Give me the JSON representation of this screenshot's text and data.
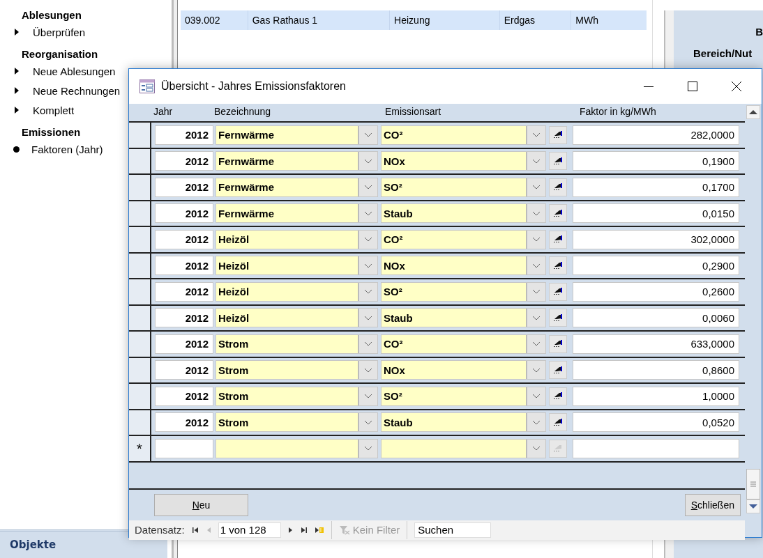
{
  "nav": {
    "sections": [
      {
        "title": "Ablesungen",
        "items": [
          {
            "label": "Überprüfen",
            "kind": "arrow"
          }
        ]
      },
      {
        "title": "Reorganisation",
        "items": [
          {
            "label": "Neue Ablesungen",
            "kind": "arrow"
          },
          {
            "label": "Neue Rechnungen",
            "kind": "arrow"
          },
          {
            "label": "Komplett",
            "kind": "arrow"
          }
        ]
      },
      {
        "title": "Emissionen",
        "items": [
          {
            "label": "Faktoren (Jahr)",
            "kind": "dot"
          }
        ]
      }
    ],
    "footer": "Objekte"
  },
  "list": {
    "rows": [
      {
        "cells": [
          "039.002",
          "Gas Rathaus 1",
          "Heizung",
          "Erdgas",
          "MWh"
        ],
        "selected": true
      }
    ]
  },
  "detail": {
    "texts": [
      "B",
      "Bereich/Nut"
    ]
  },
  "dialog": {
    "title": "Übersicht - Jahres Emissionsfaktoren",
    "columns": [
      "Jahr",
      "Bezeichnung",
      "Emissionsart",
      "Faktor in kg/MWh"
    ],
    "rows": [
      {
        "year": "2012",
        "name": "Fernwärme",
        "type": "CO²",
        "factor": "282,0000"
      },
      {
        "year": "2012",
        "name": "Fernwärme",
        "type": "NOx",
        "factor": "0,1900"
      },
      {
        "year": "2012",
        "name": "Fernwärme",
        "type": "SO²",
        "factor": "0,1700"
      },
      {
        "year": "2012",
        "name": "Fernwärme",
        "type": "Staub",
        "factor": "0,0150"
      },
      {
        "year": "2012",
        "name": "Heizöl",
        "type": "CO²",
        "factor": "302,0000"
      },
      {
        "year": "2012",
        "name": "Heizöl",
        "type": "NOx",
        "factor": "0,2900"
      },
      {
        "year": "2012",
        "name": "Heizöl",
        "type": "SO²",
        "factor": "0,2600"
      },
      {
        "year": "2012",
        "name": "Heizöl",
        "type": "Staub",
        "factor": "0,0060"
      },
      {
        "year": "2012",
        "name": "Strom",
        "type": "CO²",
        "factor": "633,0000"
      },
      {
        "year": "2012",
        "name": "Strom",
        "type": "NOx",
        "factor": "0,8600"
      },
      {
        "year": "2012",
        "name": "Strom",
        "type": "SO²",
        "factor": "1,0000"
      },
      {
        "year": "2012",
        "name": "Strom",
        "type": "Staub",
        "factor": "0,0520"
      }
    ],
    "new_row_marker": "*",
    "buttons": [
      {
        "label": "**N**eu",
        "kind": "new"
      },
      {
        "label": "**S**chließen",
        "kind": "close"
      }
    ],
    "navigator": {
      "label": "Datensatz:",
      "position": "1 von 128",
      "filter": "Kein Filter",
      "filter_disabled": true,
      "search_placeholder": "Suchen"
    }
  }
}
